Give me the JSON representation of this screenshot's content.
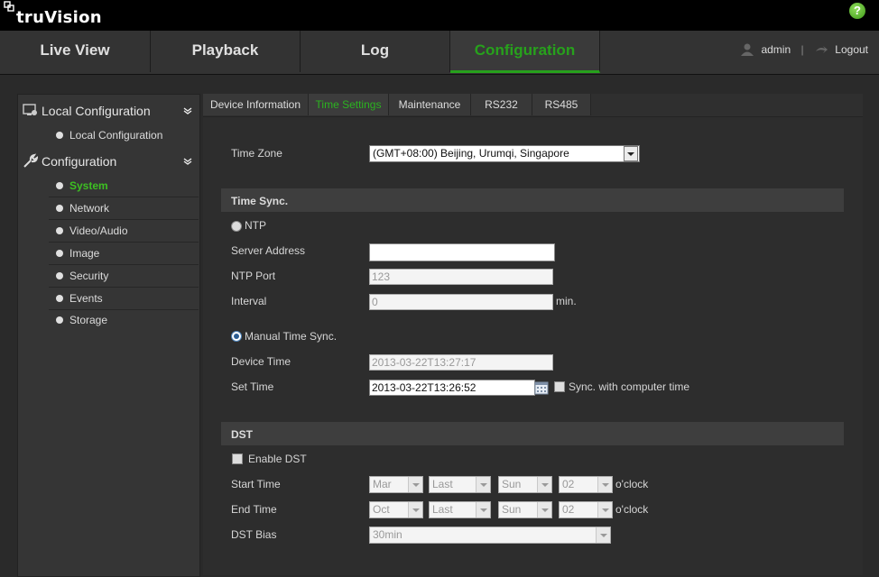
{
  "app": {
    "logo": "truVision",
    "help": "?"
  },
  "nav": {
    "tabs": [
      "Live View",
      "Playback",
      "Log",
      "Configuration"
    ],
    "active": "Configuration",
    "user": "admin",
    "logout": "Logout"
  },
  "sidebar": {
    "local_head": "Local Configuration",
    "local_item": "Local Configuration",
    "config_head": "Configuration",
    "items": [
      "System",
      "Network",
      "Video/Audio",
      "Image",
      "Security",
      "Events",
      "Storage"
    ],
    "active": "System"
  },
  "subtabs": [
    "Device Information",
    "Time Settings",
    "Maintenance",
    "RS232",
    "RS485"
  ],
  "form": {
    "time_zone_label": "Time Zone",
    "time_zone_value": "(GMT+08:00) Beijing, Urumqi, Singapore",
    "time_sync_heading": "Time Sync.",
    "ntp_label": "NTP",
    "server_address_label": "Server Address",
    "server_address_value": "",
    "ntp_port_label": "NTP Port",
    "ntp_port_value": "123",
    "interval_label": "Interval",
    "interval_value": "0",
    "interval_unit": "min.",
    "manual_label": "Manual Time Sync.",
    "device_time_label": "Device Time",
    "device_time_value": "2013-03-22T13:27:17",
    "set_time_label": "Set Time",
    "set_time_value": "2013-03-22T13:26:52",
    "sync_computer_label": "Sync. with computer time",
    "dst_heading": "DST",
    "enable_dst_label": "Enable DST",
    "start_time_label": "Start Time",
    "start": {
      "month": "Mar",
      "week": "Last",
      "day": "Sun",
      "hour": "02"
    },
    "end_time_label": "End Time",
    "end": {
      "month": "Oct",
      "week": "Last",
      "day": "Sun",
      "hour": "02"
    },
    "oclock": "o'clock",
    "dst_bias_label": "DST Bias",
    "dst_bias_value": "30min"
  },
  "colors": {
    "accent": "#27a11c",
    "background": "#2a2a2a"
  }
}
